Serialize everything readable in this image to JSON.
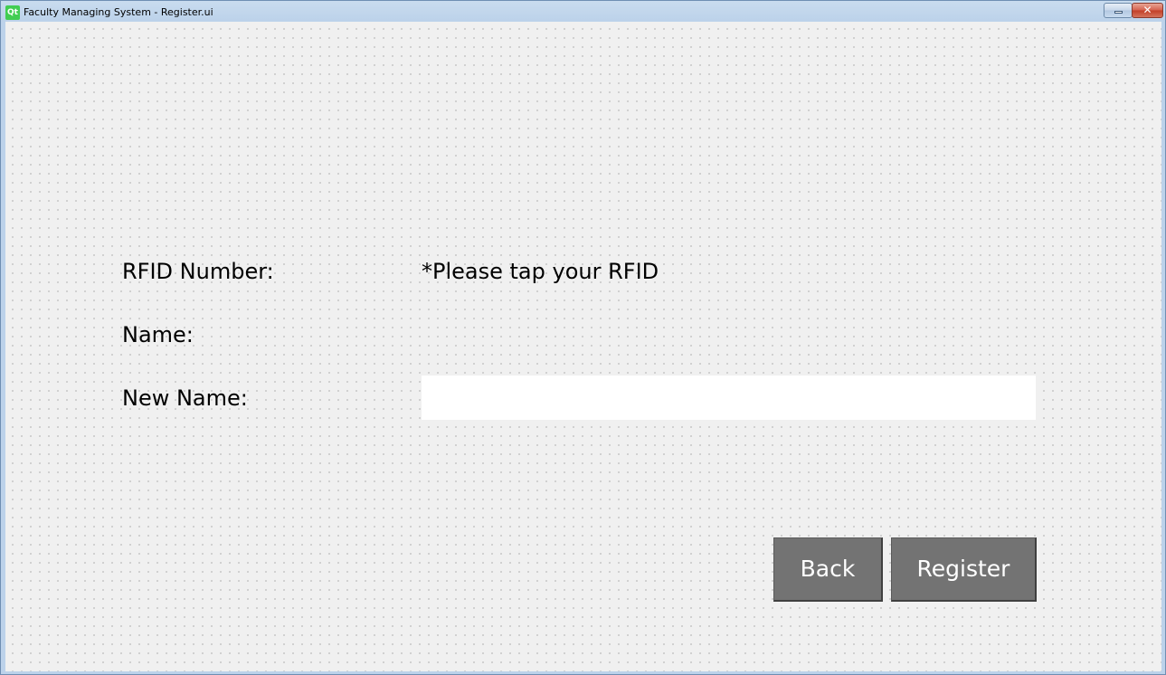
{
  "window": {
    "title": "Faculty Managing System - Register.ui",
    "app_icon_text": "Qt",
    "controls": {
      "minimize": "minimize-icon",
      "close_symbol": "✕"
    }
  },
  "form": {
    "rfid_label": "RFID Number:",
    "rfid_hint": "*Please tap your RFID",
    "name_label": "Name:",
    "name_value": "",
    "new_name_label": "New Name:",
    "new_name_value": "",
    "new_name_placeholder": ""
  },
  "buttons": {
    "back": "Back",
    "register": "Register"
  },
  "colors": {
    "button_bg": "#737373",
    "button_text": "#ffffff",
    "client_bg": "#f0f0f0",
    "qt_green": "#41cd52"
  }
}
